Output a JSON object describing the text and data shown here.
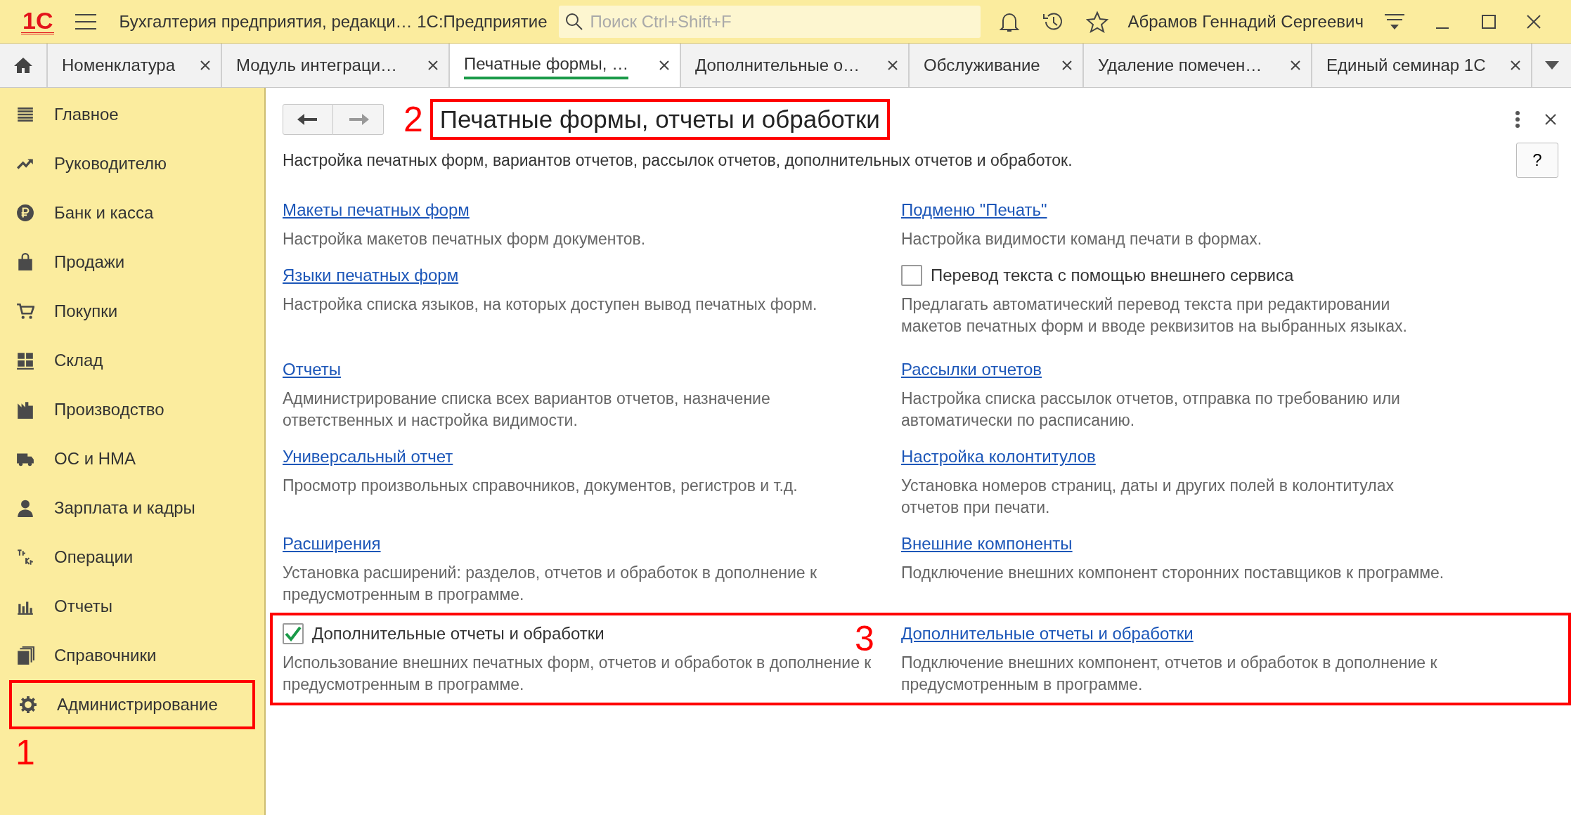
{
  "app_bar": {
    "logo": "1С",
    "title": "Бухгалтерия предприятия, редакци… 1С:Предприятие",
    "search": {
      "placeholder": "Поиск Ctrl+Shift+F"
    },
    "user": "Абрамов Геннадий Сергеевич"
  },
  "tabs": [
    {
      "label": "Номенклатура",
      "selected": false
    },
    {
      "label": "Модуль интеграци…",
      "selected": false
    },
    {
      "label": "Печатные формы, …",
      "selected": true
    },
    {
      "label": "Дополнительные о…",
      "selected": false
    },
    {
      "label": "Обслуживание",
      "selected": false
    },
    {
      "label": "Удаление помечен…",
      "selected": false
    },
    {
      "label": "Единый семинар 1С",
      "selected": false
    }
  ],
  "sidebar": {
    "items": [
      {
        "label": "Главное"
      },
      {
        "label": "Руководителю"
      },
      {
        "label": "Банк и касса"
      },
      {
        "label": "Продажи"
      },
      {
        "label": "Покупки"
      },
      {
        "label": "Склад"
      },
      {
        "label": "Производство"
      },
      {
        "label": "ОС и НМА"
      },
      {
        "label": "Зарплата и кадры"
      },
      {
        "label": "Операции"
      },
      {
        "label": "Отчеты"
      },
      {
        "label": "Справочники"
      },
      {
        "label": "Администрирование",
        "marker": "1"
      }
    ]
  },
  "form": {
    "title": "Печатные формы, отчеты и обработки",
    "title_marker": "2",
    "help": "?",
    "description": "Настройка печатных форм, вариантов отчетов, рассылок отчетов, дополнительных отчетов и обработок.",
    "rows": [
      {
        "left": {
          "kind": "link",
          "text": "Макеты печатных форм",
          "description": "Настройка макетов печатных форм документов."
        },
        "right": {
          "kind": "link",
          "text": "Подменю \"Печать\"",
          "description": "Настройка видимости команд печати в формах."
        }
      },
      {
        "left": {
          "kind": "link",
          "text": "Языки печатных форм",
          "description": "Настройка списка языков, на которых доступен вывод печатных форм."
        },
        "right": {
          "kind": "checkbox",
          "text": "Перевод текста с помощью внешнего сервиса",
          "checked": false,
          "description": "Предлагать автоматический перевод текста при редактировании макетов печатных форм и вводе реквизитов на выбранных языках."
        }
      },
      {
        "left": {
          "kind": "link",
          "text": "Отчеты",
          "description": "Администрирование списка всех вариантов отчетов, назначение ответственных и настройка видимости."
        },
        "right": {
          "kind": "link",
          "text": "Рассылки отчетов",
          "description": "Настройка списка рассылок отчетов, отправка по требованию или автоматически по расписанию."
        }
      },
      {
        "left": {
          "kind": "link",
          "text": "Универсальный отчет",
          "description": "Просмотр произвольных справочников, документов, регистров и т.д."
        },
        "right": {
          "kind": "link",
          "text": "Настройка колонтитулов",
          "description": "Установка номеров страниц, даты и других полей в колонтитулах отчетов при печати."
        }
      },
      {
        "left": {
          "kind": "link",
          "text": "Расширения",
          "description": "Установка расширений: разделов, отчетов и обработок в дополнение к предусмотренным в программе."
        },
        "right": {
          "kind": "link",
          "text": "Внешние компоненты",
          "description": "Подключение внешних компонент сторонних поставщиков к программе."
        }
      },
      {
        "marker": "3",
        "left": {
          "kind": "checkbox",
          "text": "Дополнительные отчеты и обработки",
          "checked": true,
          "description": "Использование внешних печатных форм, отчетов и обработок в дополнение к предусмотренным в программе."
        },
        "right": {
          "kind": "link",
          "text": "Дополнительные отчеты и обработки",
          "description": "Подключение внешних компонент, отчетов и обработок в дополнение к предусмотренным в программе."
        }
      }
    ]
  }
}
